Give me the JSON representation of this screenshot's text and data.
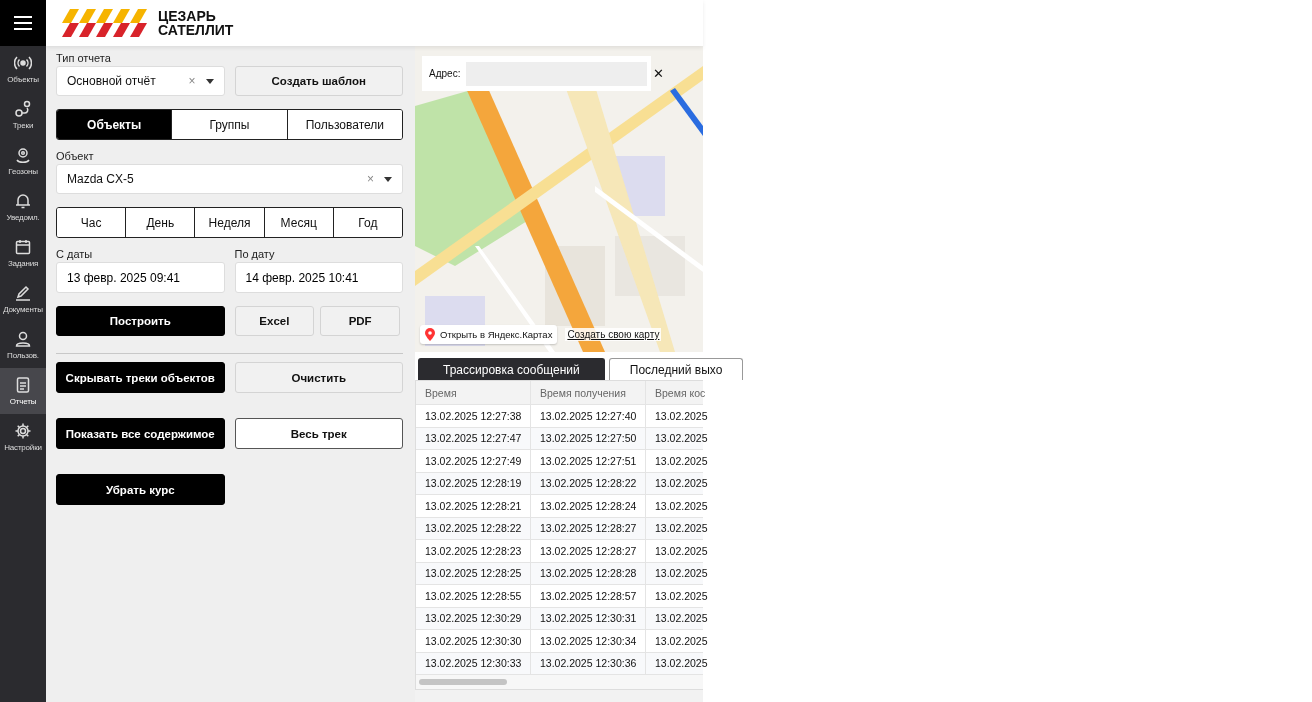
{
  "logo": {
    "line_1": "ЦЕЗАРЬ",
    "line_2": "САТЕЛЛИТ"
  },
  "sidebar": {
    "items": [
      {
        "label": "Объекты",
        "selected": false
      },
      {
        "label": "Треки",
        "selected": false
      },
      {
        "label": "Геозоны",
        "selected": false
      },
      {
        "label": "Уведомл.",
        "selected": false
      },
      {
        "label": "Задания",
        "selected": false
      },
      {
        "label": "Документы",
        "selected": false
      },
      {
        "label": "Пользов.",
        "selected": false
      },
      {
        "label": "Отчеты",
        "selected": true
      },
      {
        "label": "Настройки",
        "selected": false
      }
    ]
  },
  "report_type": {
    "label": "Тип отчета",
    "value": "Основной отчёт",
    "clear": "×"
  },
  "create_template": "Создать шаблон",
  "scope_tabs": [
    {
      "label": "Объекты",
      "selected": true
    },
    {
      "label": "Группы",
      "selected": false
    },
    {
      "label": "Пользователи",
      "selected": false
    }
  ],
  "object": {
    "label": "Объект",
    "value": "Mazda CX-5",
    "clear": "×"
  },
  "periods": [
    {
      "label": "Час",
      "selected": false
    },
    {
      "label": "День",
      "selected": false
    },
    {
      "label": "Неделя",
      "selected": false
    },
    {
      "label": "Месяц",
      "selected": false
    },
    {
      "label": "Год",
      "selected": false
    }
  ],
  "date_from": {
    "label": "С даты",
    "value": "13 февр. 2025 09:41"
  },
  "date_to": {
    "label": "По дату",
    "value": "14 февр. 2025 10:41"
  },
  "build_row": [
    {
      "label": "Построить"
    },
    {
      "label": "Excel"
    },
    {
      "label": "PDF"
    }
  ],
  "action_rows": [
    [
      {
        "label": "Скрывать треки объектов"
      },
      {
        "label": "Очистить"
      }
    ],
    [
      {
        "label": "Показать все содержимое"
      },
      {
        "label": "Весь трек"
      }
    ],
    [
      {
        "label": "Убрать курс"
      }
    ]
  ],
  "map": {
    "address_label": "Адрес:",
    "close": "✕",
    "open_link": "Открыть в Яндекс.Картах",
    "create_link": "Создать свою карту"
  },
  "result_tabs": [
    {
      "label": "Трассировка сообщений",
      "selected": true
    },
    {
      "label": "Последний выхо",
      "selected": false
    }
  ],
  "table": {
    "columns": [
      "Время",
      "Время получения",
      "Время кос"
    ],
    "rows": [
      [
        "13.02.2025 12:27:38",
        "13.02.2025 12:27:40",
        "13.02.2025"
      ],
      [
        "13.02.2025 12:27:47",
        "13.02.2025 12:27:50",
        "13.02.2025"
      ],
      [
        "13.02.2025 12:27:49",
        "13.02.2025 12:27:51",
        "13.02.2025"
      ],
      [
        "13.02.2025 12:28:19",
        "13.02.2025 12:28:22",
        "13.02.2025"
      ],
      [
        "13.02.2025 12:28:21",
        "13.02.2025 12:28:24",
        "13.02.2025"
      ],
      [
        "13.02.2025 12:28:22",
        "13.02.2025 12:28:27",
        "13.02.2025"
      ],
      [
        "13.02.2025 12:28:23",
        "13.02.2025 12:28:27",
        "13.02.2025"
      ],
      [
        "13.02.2025 12:28:25",
        "13.02.2025 12:28:28",
        "13.02.2025"
      ],
      [
        "13.02.2025 12:28:55",
        "13.02.2025 12:28:57",
        "13.02.2025"
      ],
      [
        "13.02.2025 12:30:29",
        "13.02.2025 12:30:31",
        "13.02.2025"
      ],
      [
        "13.02.2025 12:30:30",
        "13.02.2025 12:30:34",
        "13.02.2025"
      ],
      [
        "13.02.2025 12:30:33",
        "13.02.2025 12:30:36",
        "13.02.2025"
      ]
    ]
  }
}
